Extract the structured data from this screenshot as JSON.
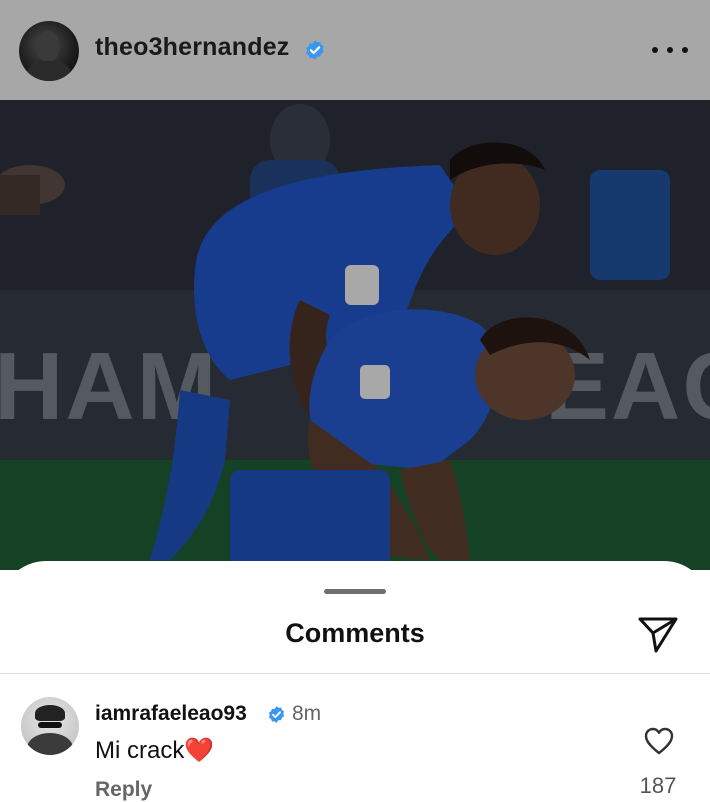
{
  "post": {
    "author": {
      "username": "theo3hernandez",
      "verified": true,
      "avatar_icon": "profile-avatar"
    },
    "more_icon": "more-horizontal-icon",
    "photo": {
      "description_icon": "post-photo",
      "banner_text_left": "HAM",
      "banner_text_right": "EAC"
    }
  },
  "comments_sheet": {
    "title": "Comments",
    "share_icon": "paper-plane-icon",
    "comments": [
      {
        "username": "iamrafaeleao93",
        "verified": true,
        "time": "8m",
        "text": "Mi crack",
        "emoji": "❤️",
        "reply_label": "Reply",
        "like_count": "187",
        "like_icon": "heart-outline-icon"
      }
    ]
  },
  "colors": {
    "header_bg": "#a7a7a7",
    "verified_blue": "#3897f0",
    "jersey_blue": "#1f56c8",
    "pitch_green": "#1f7a3a"
  }
}
